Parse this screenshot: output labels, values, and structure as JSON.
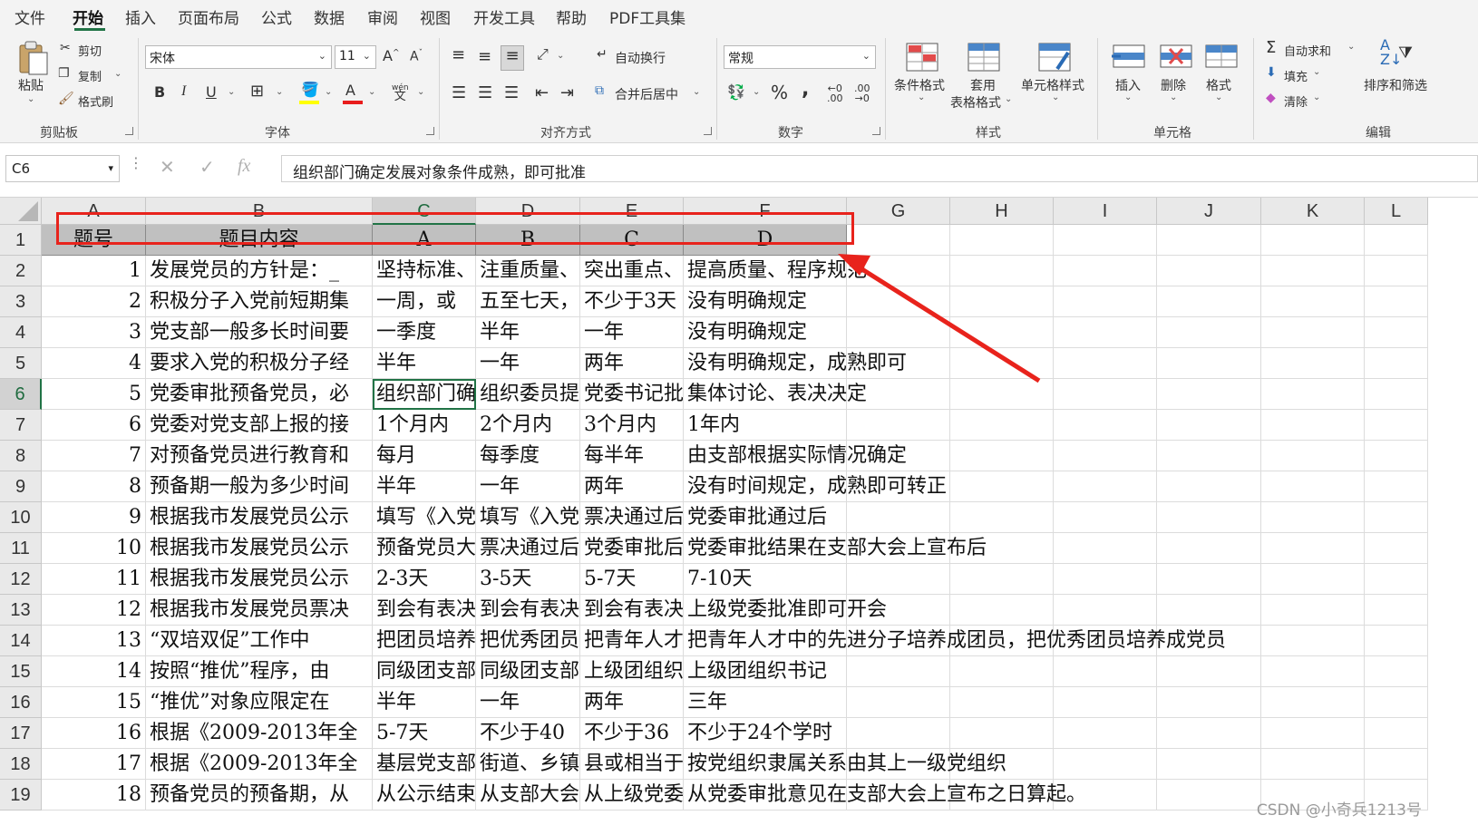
{
  "menu": {
    "items": [
      "文件",
      "开始",
      "插入",
      "页面布局",
      "公式",
      "数据",
      "审阅",
      "视图",
      "开发工具",
      "帮助",
      "PDF工具集"
    ],
    "active": "开始"
  },
  "ribbon": {
    "clipboard": {
      "paste": "粘贴",
      "cut": "剪切",
      "copy": "复制",
      "format_painter": "格式刷",
      "label": "剪贴板"
    },
    "font": {
      "name": "宋体",
      "size": "11",
      "label": "字体",
      "bold": "B",
      "italic": "I",
      "underline": "U",
      "wen": "wén"
    },
    "alignment": {
      "wrap": "自动换行",
      "merge": "合并后居中",
      "label": "对齐方式"
    },
    "number": {
      "format": "常规",
      "percent": "%",
      "comma": ",",
      "label": "数字"
    },
    "styles": {
      "conditional": "条件格式",
      "table_format_1": "套用",
      "table_format_2": "表格格式",
      "cell_styles": "单元格样式",
      "label": "样式"
    },
    "cells": {
      "insert": "插入",
      "delete": "删除",
      "format": "格式",
      "label": "单元格"
    },
    "editing": {
      "autosum": "自动求和",
      "fill": "填充",
      "clear": "清除",
      "sort_filter": "排序和筛选",
      "label": "编辑"
    }
  },
  "formula_bar": {
    "name_box": "C6",
    "formula": "组织部门确定发展对象条件成熟，即可批准"
  },
  "columns": [
    "A",
    "B",
    "C",
    "D",
    "E",
    "F",
    "G",
    "H",
    "I",
    "J",
    "K",
    "L"
  ],
  "rows": [
    "1",
    "2",
    "3",
    "4",
    "5",
    "6",
    "7",
    "8",
    "9",
    "10",
    "11",
    "12",
    "13",
    "14",
    "15",
    "16",
    "17",
    "18",
    "19"
  ],
  "active_cell": "C6",
  "header_row": [
    "题号",
    "题目内容",
    "A",
    "B",
    "C",
    "D"
  ],
  "data_rows": [
    [
      "1",
      "发展党员的方针是：_",
      "坚持标准、",
      "注重质量、",
      "突出重点、",
      "提高质量、程序规范"
    ],
    [
      "2",
      "积极分子入党前短期集",
      "一周，或",
      "五至七天，",
      "不少于3天",
      "没有明确规定"
    ],
    [
      "3",
      "党支部一般多长时间要",
      "一季度",
      "半年",
      "一年",
      "没有明确规定"
    ],
    [
      "4",
      "要求入党的积极分子经",
      "半年",
      "一年",
      "两年",
      "没有明确规定，成熟即可"
    ],
    [
      "5",
      "党委审批预备党员，必",
      "组织部门确",
      "组织委员提",
      "党委书记批",
      "集体讨论、表决决定"
    ],
    [
      "6",
      "党委对党支部上报的接",
      "1个月内",
      "2个月内",
      "3个月内",
      "1年内"
    ],
    [
      "7",
      "对预备党员进行教育和",
      "每月",
      "每季度",
      "每半年",
      "由支部根据实际情况确定"
    ],
    [
      "8",
      "预备期一般为多少时间",
      "半年",
      "一年",
      "两年",
      "没有时间规定，成熟即可转正"
    ],
    [
      "9",
      "根据我市发展党员公示",
      "填写《入党",
      "填写《入党",
      "票决通过后",
      "党委审批通过后"
    ],
    [
      "10",
      "根据我市发展党员公示",
      "预备党员大",
      "票决通过后",
      "党委审批后",
      "党委审批结果在支部大会上宣布后"
    ],
    [
      "11",
      "根据我市发展党员公示",
      "2-3天",
      "3-5天",
      "5-7天",
      "7-10天"
    ],
    [
      "12",
      "根据我市发展党员票决",
      "到会有表决",
      "到会有表决",
      "到会有表决",
      "上级党委批准即可开会"
    ],
    [
      "13",
      "“双培双促”工作中",
      "把团员培养",
      "把优秀团员",
      "把青年人才",
      "把青年人才中的先进分子培养成团员，把优秀团员培养成党员"
    ],
    [
      "14",
      "按照“推优”程序，由",
      "同级团支部",
      "同级团支部",
      "上级团组织",
      "上级团组织书记"
    ],
    [
      "15",
      "“推优”对象应限定在",
      "半年",
      "一年",
      "两年",
      "三年"
    ],
    [
      "16",
      "根据《2009-2013年全",
      "5-7天",
      "不少于40",
      "不少于36",
      "不少于24个学时"
    ],
    [
      "17",
      "根据《2009-2013年全",
      "基层党支部",
      "街道、乡镇",
      "县或相当于",
      "按党组织隶属关系由其上一级党组织"
    ],
    [
      "18",
      "预备党员的预备期，从",
      "从公示结束",
      "从支部大会",
      "从上级党委",
      "从党委审批意见在支部大会上宣布之日算起。"
    ]
  ],
  "watermark": "CSDN @小奇兵1213号",
  "accent_color": "#217346",
  "annotation_color": "#e8231c"
}
